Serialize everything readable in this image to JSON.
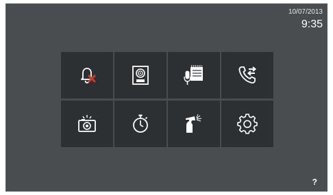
{
  "status": {
    "date": "10/07/2013",
    "time": "9:35"
  },
  "menu": {
    "tiles": [
      {
        "icon": "bell-muted-icon"
      },
      {
        "icon": "intercom-camera-icon"
      },
      {
        "icon": "voice-memo-icon"
      },
      {
        "icon": "call-transfer-icon"
      },
      {
        "icon": "camera-snapshot-icon"
      },
      {
        "icon": "stopwatch-icon"
      },
      {
        "icon": "cleaning-spray-icon"
      },
      {
        "icon": "gear-icon"
      }
    ]
  },
  "help": {
    "label": "?"
  },
  "colors": {
    "background": "#4a4d4f",
    "tile": "#2d3033",
    "accent_red": "#d33a2c",
    "icon": "#ffffff"
  }
}
